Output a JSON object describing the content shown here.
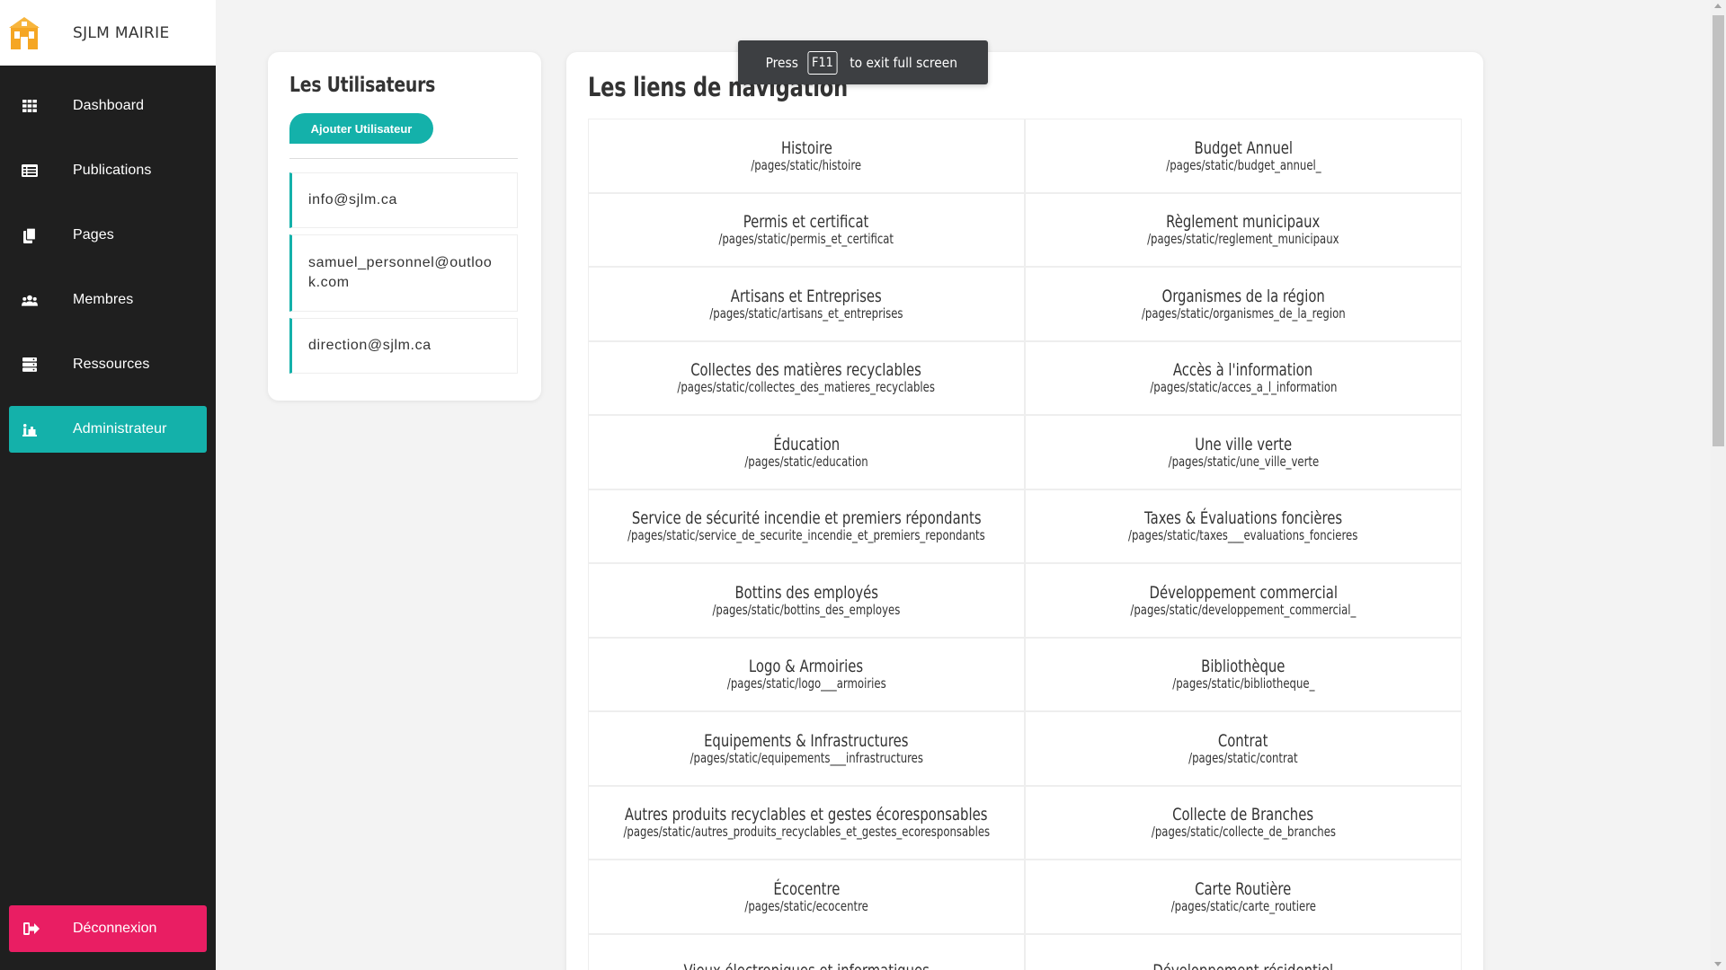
{
  "app": {
    "name": "SJLM MAIRIE",
    "logo_color": "#f5a623"
  },
  "sidebar": {
    "items": [
      {
        "label": "Dashboard",
        "icon": "grid-icon"
      },
      {
        "label": "Publications",
        "icon": "list-icon"
      },
      {
        "label": "Pages",
        "icon": "copy-icon"
      },
      {
        "label": "Membres",
        "icon": "users-icon"
      },
      {
        "label": "Ressources",
        "icon": "server-icon"
      },
      {
        "label": "Administrateur",
        "icon": "user-tie-icon",
        "active": true
      }
    ],
    "logout_label": "Déconnexion",
    "active_color": "#14b1aa",
    "logout_color": "#e91e63"
  },
  "users": {
    "title": "Les Utilisateurs",
    "add_button": "Ajouter Utilisateur",
    "emails": [
      "info@sjlm.ca",
      "samuel_personnel@outlook.com",
      "direction@sjlm.ca"
    ]
  },
  "links": {
    "title": "Les liens de navigation",
    "items": [
      {
        "name": "Histoire",
        "path": "/pages/static/histoire"
      },
      {
        "name": "Budget Annuel",
        "path": "/pages/static/budget_annuel_"
      },
      {
        "name": "Permis et certificat",
        "path": "/pages/static/permis_et_certificat"
      },
      {
        "name": "Règlement municipaux",
        "path": "/pages/static/reglement_municipaux"
      },
      {
        "name": "Artisans et Entreprises",
        "path": "/pages/static/artisans_et_entreprises"
      },
      {
        "name": "Organismes de la région",
        "path": "/pages/static/organismes_de_la_region"
      },
      {
        "name": "Collectes des matières recyclables",
        "path": "/pages/static/collectes_des_matieres_recyclables"
      },
      {
        "name": "Accès à l'information",
        "path": "/pages/static/acces_a_l_information"
      },
      {
        "name": "Éducation",
        "path": "/pages/static/education"
      },
      {
        "name": "Une ville verte",
        "path": "/pages/static/une_ville_verte"
      },
      {
        "name": "Service de sécurité incendie et premiers répondants",
        "path": "/pages/static/service_de_securite_incendie_et_premiers_repondants"
      },
      {
        "name": "Taxes & Évaluations foncières",
        "path": "/pages/static/taxes___evaluations_foncieres"
      },
      {
        "name": "Bottins des employés",
        "path": "/pages/static/bottins_des_employes"
      },
      {
        "name": "Développement commercial",
        "path": "/pages/static/developpement_commercial_"
      },
      {
        "name": "Logo & Armoiries",
        "path": "/pages/static/logo___armoiries"
      },
      {
        "name": "Bibliothèque",
        "path": "/pages/static/bibliotheque_"
      },
      {
        "name": "Equipements & Infrastructures",
        "path": "/pages/static/equipements___infrastructures"
      },
      {
        "name": "Contrat",
        "path": "/pages/static/contrat"
      },
      {
        "name": "Autres produits recyclables et gestes écoresponsables",
        "path": "/pages/static/autres_produits_recyclables_et_gestes_ecoresponsables"
      },
      {
        "name": "Collecte de Branches",
        "path": "/pages/static/collecte_de_branches"
      },
      {
        "name": "Écocentre",
        "path": "/pages/static/ecocentre"
      },
      {
        "name": "Carte Routière",
        "path": "/pages/static/carte_routiere"
      },
      {
        "name": "Vieux électroniques et informatiques",
        "path": ""
      },
      {
        "name": "Développement résidentiel",
        "path": ""
      }
    ]
  },
  "toast": {
    "prefix": "Press",
    "key": "F11",
    "suffix": "to exit full screen"
  }
}
